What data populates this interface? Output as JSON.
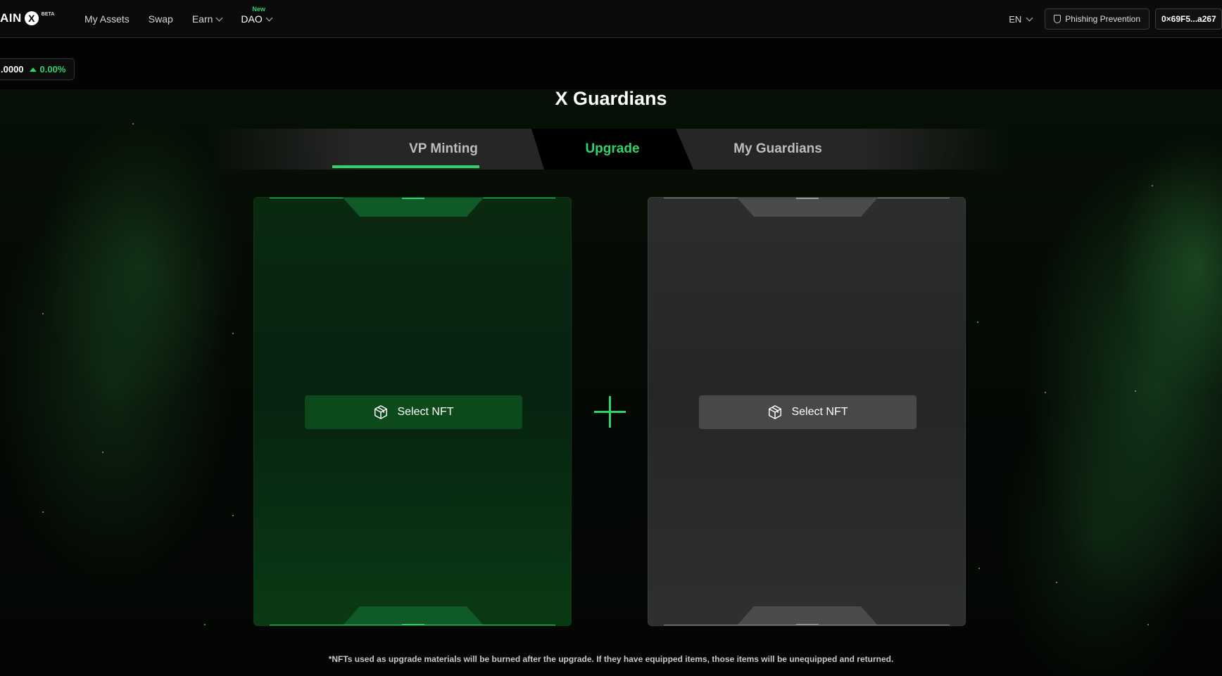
{
  "header": {
    "logo_text": "AIN",
    "logo_mark": "X",
    "logo_badge": "BETA",
    "nav": [
      {
        "label": "My Assets"
      },
      {
        "label": "Swap"
      },
      {
        "label": "Earn"
      },
      {
        "label": "DAO",
        "badge": "New"
      }
    ],
    "lang": "EN",
    "phishing_label": "Phishing Prevention",
    "wallet_label": "0×69F5...a267"
  },
  "price": {
    "value": ".0000",
    "change": "0.00%",
    "trend_color": "#2fd36a"
  },
  "page": {
    "title": "X Guardians",
    "tabs": [
      {
        "label": "VP Minting",
        "active": false
      },
      {
        "label": "Upgrade",
        "active": true
      },
      {
        "label": "My Guardians",
        "active": false
      }
    ]
  },
  "slots": [
    {
      "button_label": "Select NFT",
      "icon": "box-icon",
      "accent": "#2fd36a"
    },
    {
      "button_label": "Select NFT",
      "icon": "box-icon",
      "accent": "#8a8a8a"
    }
  ],
  "footnote": "*NFTs used as upgrade materials will be burned after the upgrade. If they have equipped items, those items will be unequipped and returned."
}
